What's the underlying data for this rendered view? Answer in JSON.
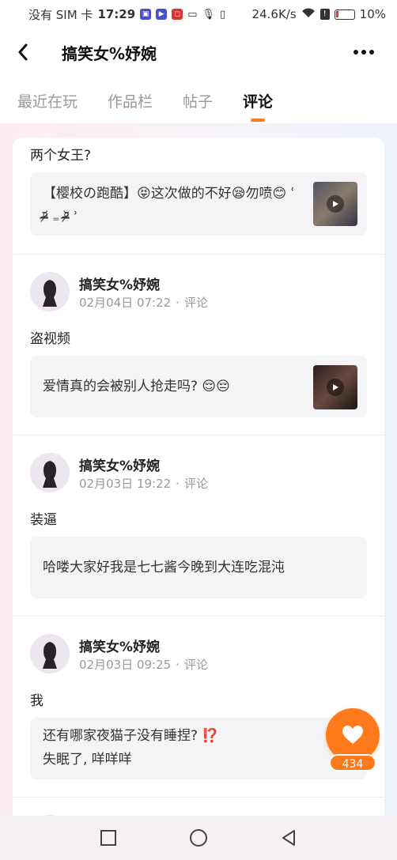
{
  "status_bar": {
    "carrier": "没有 SIM 卡",
    "time": "17:29",
    "network_speed": "24.6K/s",
    "battery_percent": "10%"
  },
  "header": {
    "title": "搞笑女%妤婉"
  },
  "tabs": [
    {
      "label": "最近在玩",
      "active": false
    },
    {
      "label": "作品栏",
      "active": false
    },
    {
      "label": "帖子",
      "active": false
    },
    {
      "label": "评论",
      "active": true
    }
  ],
  "top_partial": {
    "text": "两个女王?",
    "quote": "【樱校の跑酷】😝这次做的不好😪勿喷😊 ʿ ᵒ̴̶̷᷄ ₌ ᵒ̴̶̷᷅ ʾ"
  },
  "posts": [
    {
      "username": "搞笑女%妤婉",
      "date": "02月04日 07:22",
      "type": "评论",
      "body": "盗视频",
      "quote": "爱情真的会被别人抢走吗? 😌😔",
      "has_thumb": true
    },
    {
      "username": "搞笑女%妤婉",
      "date": "02月03日 19:22",
      "type": "评论",
      "body": "装逼",
      "quote": "哈喽大家好我是七七酱今晚到大连吃混沌",
      "has_thumb": false
    },
    {
      "username": "搞笑女%妤婉",
      "date": "02月03日 09:25",
      "type": "评论",
      "body": "我",
      "quote_line1": "还有哪家夜猫子没有睡捏? ⁉️",
      "quote_line2": "失眠了, 咩咩咩",
      "has_thumb": false
    }
  ],
  "like": {
    "count": "434",
    "color": "#ff7a1a"
  }
}
